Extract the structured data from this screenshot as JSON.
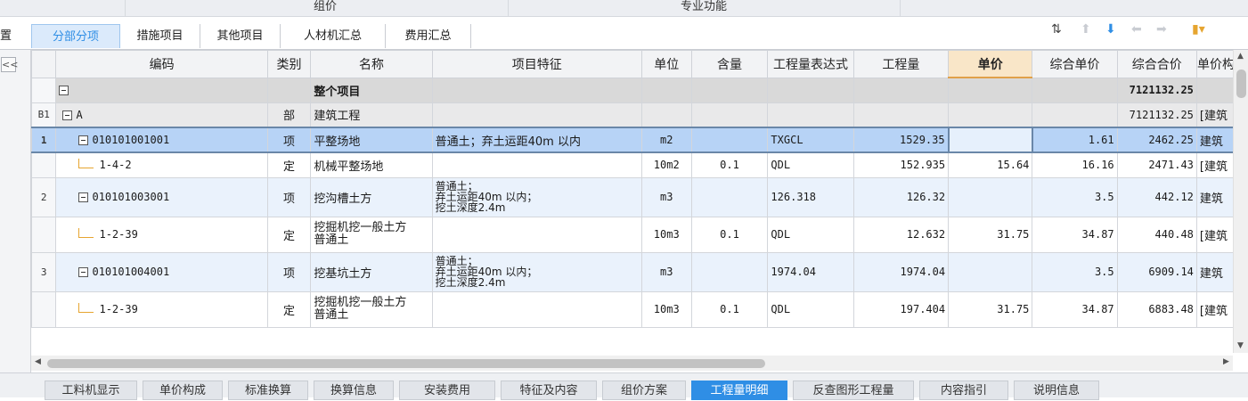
{
  "group_header": [
    "组价",
    "专业功能"
  ],
  "edge_label": "置",
  "tabs": [
    {
      "label": "分部分项",
      "active": true
    },
    {
      "label": "措施项目",
      "active": false
    },
    {
      "label": "其他项目",
      "active": false
    },
    {
      "label": "人材机汇总",
      "active": false
    },
    {
      "label": "费用汇总",
      "active": false
    }
  ],
  "toolbar_icons": [
    "sort-icon",
    "arrow-up-icon",
    "arrow-down-icon",
    "arrow-left-icon",
    "arrow-right-icon",
    "palette-icon"
  ],
  "collapse_label": "<<",
  "columns": [
    "编码",
    "类别",
    "名称",
    "项目特征",
    "单位",
    "含量",
    "工程量表达式",
    "工程量",
    "单价",
    "综合单价",
    "综合合价",
    "单价构成"
  ],
  "highlighted_column": "单价",
  "rows": [
    {
      "type": "proj",
      "rn": "",
      "code": "",
      "cat": "",
      "name": "整个项目",
      "feat": "",
      "unit": "",
      "qty_ratio": "",
      "expr": "",
      "qty": "",
      "price": "",
      "unit_total": "",
      "total": "7121132.25",
      "extra": ""
    },
    {
      "type": "sec",
      "rn": "B1",
      "code": "A",
      "cat": "部",
      "name": "建筑工程",
      "feat": "",
      "unit": "",
      "qty_ratio": "",
      "expr": "",
      "qty": "",
      "price": "",
      "unit_total": "",
      "total": "7121132.25",
      "extra": "[建筑"
    },
    {
      "type": "sel",
      "rn": "1",
      "code": "010101001001",
      "cat": "项",
      "name": "平整场地",
      "feat": "普通土；弃土运距40m 以内",
      "unit": "m2",
      "qty_ratio": "",
      "expr": "TXGCL",
      "qty": "1529.35",
      "price": "",
      "unit_total": "1.61",
      "total": "2462.25",
      "extra": "建筑"
    },
    {
      "type": "sub",
      "rn": "",
      "code": "1-4-2",
      "cat": "定",
      "name": "机械平整场地",
      "feat": "",
      "unit": "10m2",
      "qty_ratio": "0.1",
      "expr": "QDL",
      "qty": "152.935",
      "price": "15.64",
      "unit_total": "16.16",
      "total": "2471.43",
      "extra": "[建筑"
    },
    {
      "type": "item",
      "rn": "2",
      "code": "010101003001",
      "cat": "项",
      "name": "挖沟槽土方",
      "feat": "普通土；\n弃土运距40m 以内；\n挖土深度2.4m",
      "unit": "m3",
      "qty_ratio": "",
      "expr": "126.318",
      "qty": "126.32",
      "price": "",
      "unit_total": "3.5",
      "total": "442.12",
      "extra": "建筑"
    },
    {
      "type": "sub",
      "rn": "",
      "code": "1-2-39",
      "cat": "定",
      "name": "挖掘机挖一般土方\n普通土",
      "feat": "",
      "unit": "10m3",
      "qty_ratio": "0.1",
      "expr": "QDL",
      "qty": "12.632",
      "price": "31.75",
      "unit_total": "34.87",
      "total": "440.48",
      "extra": "[建筑"
    },
    {
      "type": "item",
      "rn": "3",
      "code": "010101004001",
      "cat": "项",
      "name": "挖基坑土方",
      "feat": "普通土；\n弃土运距40m 以内；\n挖土深度2.4m",
      "unit": "m3",
      "qty_ratio": "",
      "expr": "1974.04",
      "qty": "1974.04",
      "price": "",
      "unit_total": "3.5",
      "total": "6909.14",
      "extra": "建筑"
    },
    {
      "type": "sub",
      "rn": "",
      "code": "1-2-39",
      "cat": "定",
      "name": "挖掘机挖一般土方\n普通土",
      "feat": "",
      "unit": "10m3",
      "qty_ratio": "0.1",
      "expr": "QDL",
      "qty": "197.404",
      "price": "31.75",
      "unit_total": "34.87",
      "total": "6883.48",
      "extra": "[建筑"
    }
  ],
  "bottom_tabs": [
    {
      "label": "工料机显示",
      "active": false
    },
    {
      "label": "单价构成",
      "active": false
    },
    {
      "label": "标准换算",
      "active": false
    },
    {
      "label": "换算信息",
      "active": false
    },
    {
      "label": "安装费用",
      "active": false
    },
    {
      "label": "特征及内容",
      "active": false
    },
    {
      "label": "组价方案",
      "active": false
    },
    {
      "label": "工程量明细",
      "active": true
    },
    {
      "label": "反查图形工程量",
      "active": false
    },
    {
      "label": "内容指引",
      "active": false
    },
    {
      "label": "说明信息",
      "active": false
    }
  ],
  "colors": {
    "accent": "#2f8ee5",
    "selected_row": "#b7d3f6",
    "highlight_header": "#f9e6c8"
  }
}
